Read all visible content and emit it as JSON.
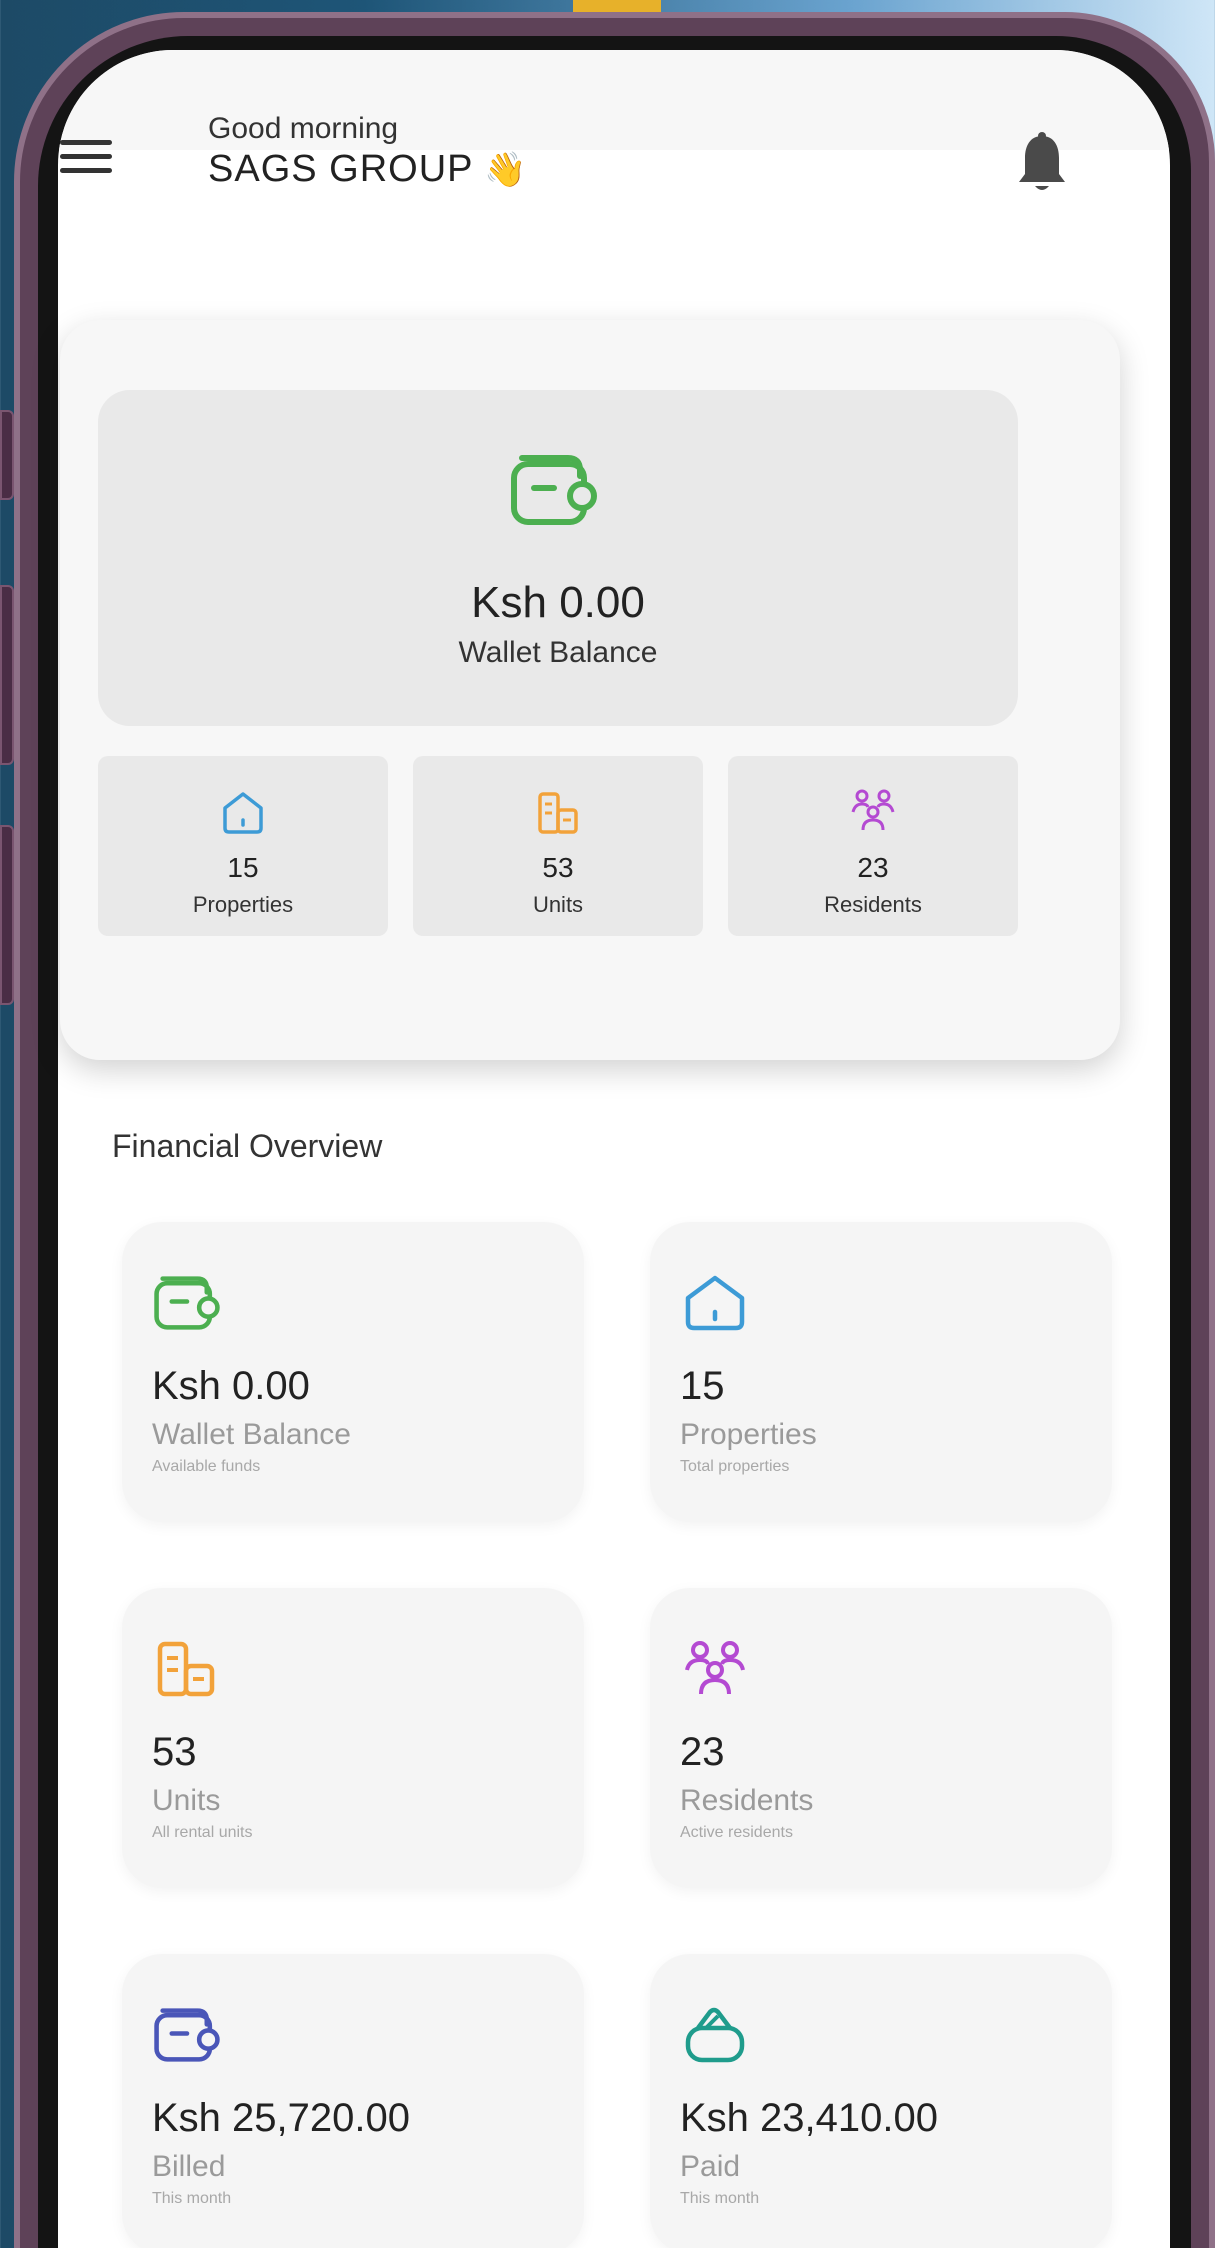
{
  "header": {
    "greeting": "Good morning",
    "company": "SAGS GROUP",
    "wave_emoji": "👋"
  },
  "summary": {
    "wallet_amount": "Ksh 0.00",
    "wallet_label": "Wallet Balance",
    "stats": [
      {
        "value": "15",
        "label": "Properties",
        "icon": "house-icon"
      },
      {
        "value": "53",
        "label": "Units",
        "icon": "building-icon"
      },
      {
        "value": "23",
        "label": "Residents",
        "icon": "people-icon"
      }
    ]
  },
  "financial": {
    "title": "Financial Overview",
    "cards": [
      {
        "value": "Ksh 0.00",
        "title": "Wallet Balance",
        "subtitle": "Available funds",
        "icon": "wallet-icon"
      },
      {
        "value": "15",
        "title": "Properties",
        "subtitle": "Total properties",
        "icon": "house-icon"
      },
      {
        "value": "53",
        "title": "Units",
        "subtitle": "All rental units",
        "icon": "building-icon"
      },
      {
        "value": "23",
        "title": "Residents",
        "subtitle": "Active residents",
        "icon": "people-icon"
      },
      {
        "value": "Ksh 25,720.00",
        "title": "Billed",
        "subtitle": "This month",
        "icon": "wallet-icon"
      },
      {
        "value": "Ksh 23,410.00",
        "title": "Paid",
        "subtitle": "This month",
        "icon": "purse-icon"
      }
    ]
  },
  "colors": {
    "wallet_green": "#4caf50",
    "house_blue": "#3d9bd6",
    "units_orange": "#f2a23a",
    "residents_purple": "#b44ad2",
    "billed_indigo": "#4a56b8",
    "paid_teal": "#1f9c8c"
  }
}
